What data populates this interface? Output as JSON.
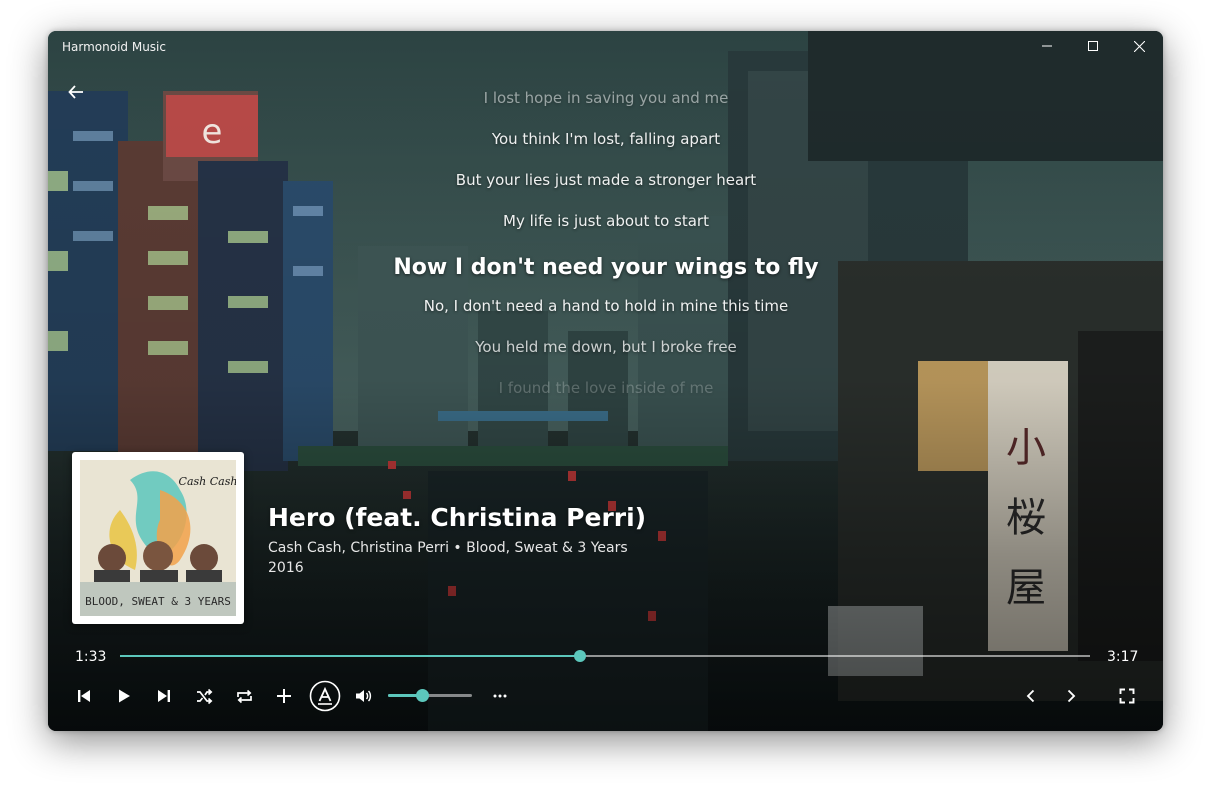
{
  "window": {
    "title": "Harmonoid Music",
    "minimize_icon": "minimize-icon",
    "maximize_icon": "maximize-icon",
    "close_icon": "close-icon"
  },
  "navigation": {
    "back_icon": "arrow-left-icon"
  },
  "lyrics": {
    "lines": [
      "I lost hope in saving you and me",
      "You think I'm lost, falling apart",
      "But your lies just made a stronger heart",
      "My life is just about to start",
      "Now I don't need your wings to fly",
      "No, I don't need a hand to hold in mine this time",
      "You held me down, but I broke free",
      "I found the love inside of me"
    ],
    "current_index": 4
  },
  "album_art": {
    "artist_logo": "Cash Cash",
    "album_text": "BLOOD, SWEAT & 3 YEARS"
  },
  "track": {
    "title": "Hero (feat. Christina Perri)",
    "subtitle": "Cash Cash, Christina Perri • Blood, Sweat & 3 Years",
    "year": "2016"
  },
  "playback": {
    "elapsed": "1:33",
    "duration": "3:17",
    "progress": 0.474,
    "volume": 0.4
  },
  "controls": {
    "skip_previous_icon": "skip-previous-icon",
    "play_icon": "play-icon",
    "skip_next_icon": "skip-next-icon",
    "shuffle_icon": "shuffle-icon",
    "repeat_icon": "repeat-icon",
    "add_icon": "add-icon",
    "lyrics_icon": "lyrics-icon",
    "volume_icon": "volume-icon",
    "more_icon": "more-horizontal-icon",
    "previous_page_icon": "chevron-left-icon",
    "next_page_icon": "chevron-right-icon",
    "fullscreen_icon": "fullscreen-icon"
  },
  "colors": {
    "accent": "#5cc7bc",
    "text": "#ffffff"
  }
}
